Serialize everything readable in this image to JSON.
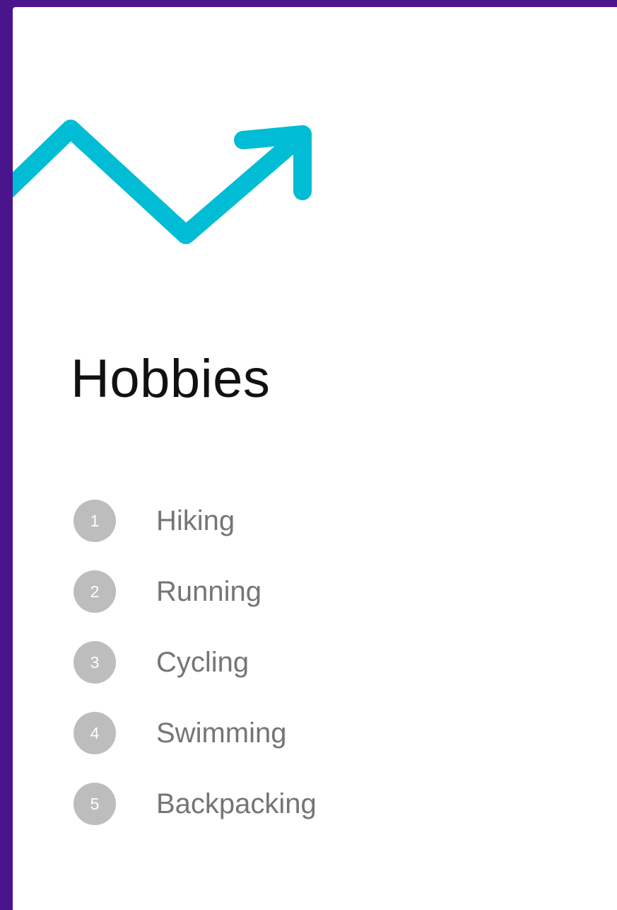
{
  "colors": {
    "frame": "#4a148c",
    "card": "#ffffff",
    "accent": "#00bcd4",
    "badge": "#bdbdbd",
    "badge_text": "#ffffff",
    "title": "#111111",
    "item_text": "#757575"
  },
  "header": {
    "icon": "trending-up-icon"
  },
  "title": "Hobbies",
  "hobbies": [
    {
      "number": "1",
      "label": "Hiking"
    },
    {
      "number": "2",
      "label": "Running"
    },
    {
      "number": "3",
      "label": "Cycling"
    },
    {
      "number": "4",
      "label": "Swimming"
    },
    {
      "number": "5",
      "label": "Backpacking"
    }
  ]
}
